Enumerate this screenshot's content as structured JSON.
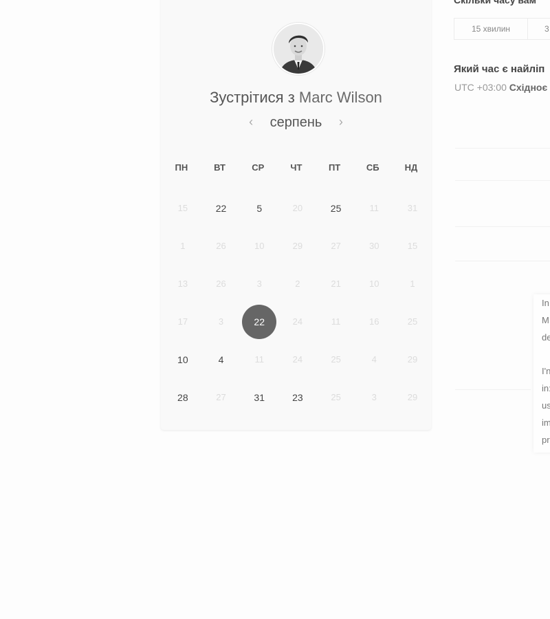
{
  "header": {
    "title_prefix": "Зустрітися з",
    "host_name": "Marc Wilson"
  },
  "calendar": {
    "month": "серпень",
    "prev_icon": "chevron-left-icon",
    "next_icon": "chevron-right-icon",
    "weekdays": [
      "ПН",
      "ВТ",
      "СР",
      "ЧТ",
      "ПТ",
      "СБ",
      "НД"
    ],
    "selected_day": "22",
    "rows": [
      [
        {
          "d": "15",
          "s": "off"
        },
        {
          "d": "22",
          "s": "on"
        },
        {
          "d": "5",
          "s": "on"
        },
        {
          "d": "20",
          "s": "off"
        },
        {
          "d": "25",
          "s": "on"
        },
        {
          "d": "11",
          "s": "off"
        },
        {
          "d": "31",
          "s": "off"
        }
      ],
      [
        {
          "d": "1",
          "s": "off"
        },
        {
          "d": "26",
          "s": "off"
        },
        {
          "d": "10",
          "s": "off"
        },
        {
          "d": "29",
          "s": "off"
        },
        {
          "d": "27",
          "s": "off"
        },
        {
          "d": "30",
          "s": "off"
        },
        {
          "d": "15",
          "s": "off"
        }
      ],
      [
        {
          "d": "13",
          "s": "off"
        },
        {
          "d": "26",
          "s": "off"
        },
        {
          "d": "3",
          "s": "off"
        },
        {
          "d": "2",
          "s": "off"
        },
        {
          "d": "21",
          "s": "off"
        },
        {
          "d": "10",
          "s": "off"
        },
        {
          "d": "1",
          "s": "off"
        }
      ],
      [
        {
          "d": "17",
          "s": "off"
        },
        {
          "d": "3",
          "s": "off"
        },
        {
          "d": "22",
          "s": "sel"
        },
        {
          "d": "24",
          "s": "off"
        },
        {
          "d": "11",
          "s": "off"
        },
        {
          "d": "16",
          "s": "off"
        },
        {
          "d": "25",
          "s": "off"
        }
      ],
      [
        {
          "d": "10",
          "s": "on"
        },
        {
          "d": "4",
          "s": "on"
        },
        {
          "d": "11",
          "s": "off"
        },
        {
          "d": "24",
          "s": "off"
        },
        {
          "d": "25",
          "s": "off"
        },
        {
          "d": "4",
          "s": "off"
        },
        {
          "d": "29",
          "s": "off"
        }
      ],
      [
        {
          "d": "28",
          "s": "on"
        },
        {
          "d": "27",
          "s": "off"
        },
        {
          "d": "31",
          "s": "on"
        },
        {
          "d": "23",
          "s": "on"
        },
        {
          "d": "25",
          "s": "off"
        },
        {
          "d": "3",
          "s": "off"
        },
        {
          "d": "29",
          "s": "off"
        }
      ]
    ]
  },
  "booking": {
    "duration_question": "Скільки часу вам",
    "durations": [
      "15 хвилин",
      "3"
    ],
    "time_question": "Який час є найліп",
    "timezone_offset": "UTC +03:00",
    "timezone_name": "Східноє"
  },
  "about": {
    "lines_1": [
      "In",
      "M",
      "de"
    ],
    "lines_2": [
      "I'n",
      "in:",
      "us",
      "im",
      "pr"
    ]
  }
}
